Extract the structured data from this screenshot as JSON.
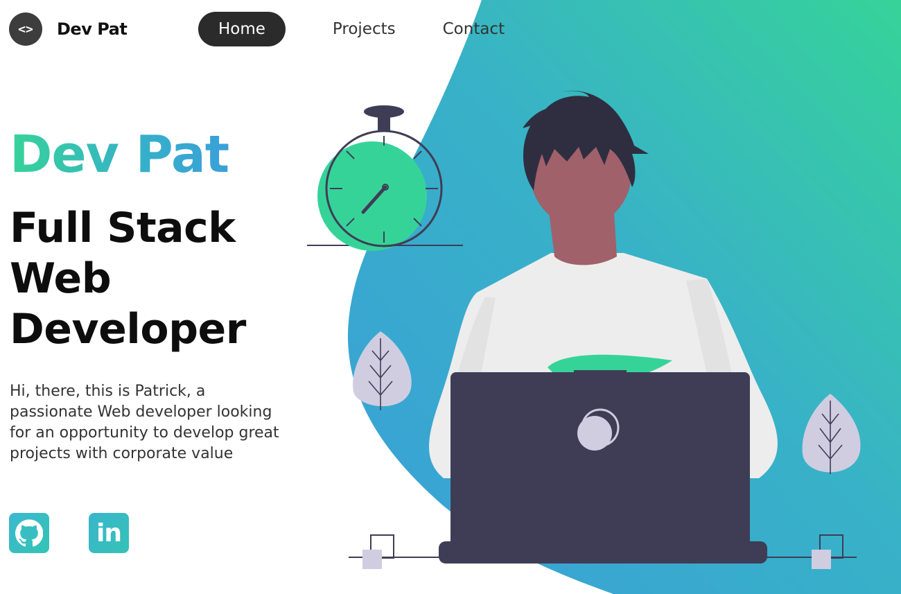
{
  "header": {
    "logo_symbol": "<>",
    "brand": "Dev Pat",
    "nav": [
      {
        "label": "Home",
        "active": true
      },
      {
        "label": "Projects",
        "active": false
      },
      {
        "label": "Contact",
        "active": false
      }
    ]
  },
  "hero": {
    "name": "Dev Pat",
    "title_lines": [
      "Full Stack",
      "Web",
      "Developer"
    ],
    "description": "Hi, there, this is Patrick, a passionate Web developer looking for an opportunity to develop great projects with corporate value"
  },
  "social": [
    {
      "icon": "github-icon"
    },
    {
      "icon": "linkedin-icon",
      "glyph": "in"
    }
  ],
  "colors": {
    "gradient_start": "#36d399",
    "gradient_end": "#3a9fd8",
    "nav_active_bg": "#2b2b2b",
    "laptop": "#3f3d56",
    "skin": "#a0616a",
    "hair": "#2f2e41",
    "shirt": "#ededed",
    "leaf": "#d0cde1"
  }
}
